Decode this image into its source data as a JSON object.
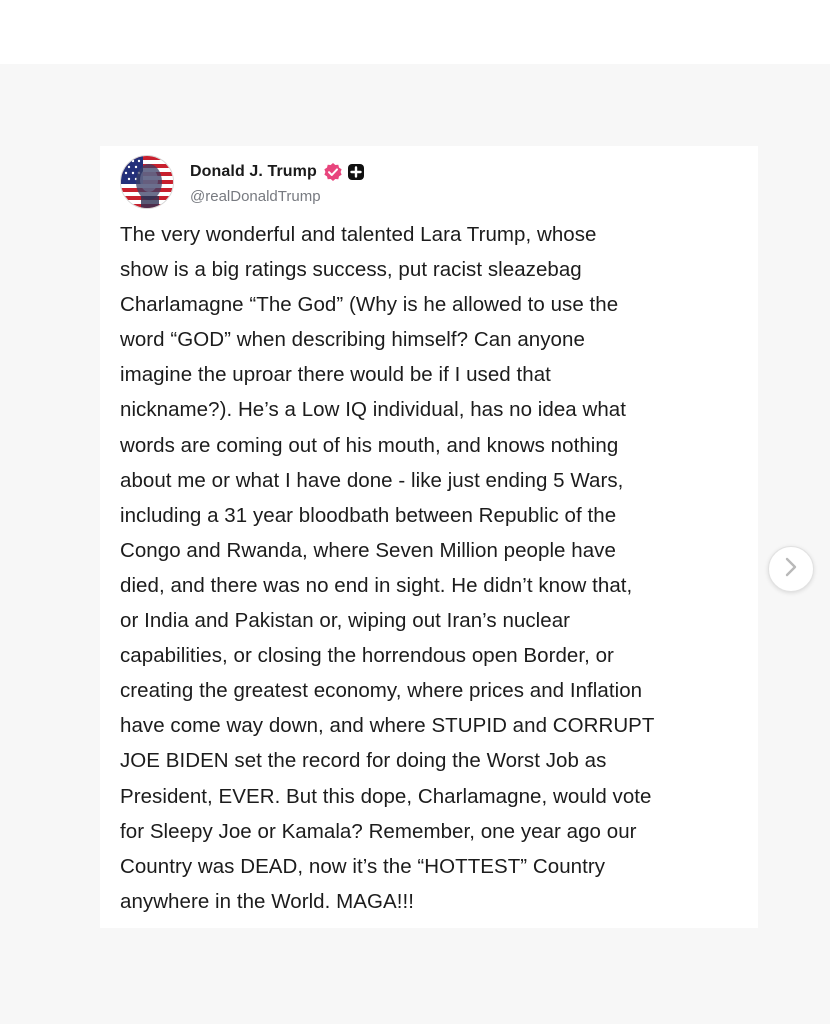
{
  "post": {
    "author": {
      "display_name": "Donald J. Trump",
      "handle": "@realDonaldTrump",
      "avatar": "flag-portrait-avatar",
      "verified_icon": "verified-badge-icon",
      "extra_icon": "plus-badge-icon"
    },
    "text": "The very wonderful and talented Lara Trump, whose\nshow is a big ratings success, put racist sleazebag\nCharlamagne “The God” (Why is he allowed  to use the\nword “GOD” when describing himself? Can anyone\nimagine the uproar there would be if I used that\nnickname?). He’s a Low IQ individual, has no idea what\nwords are coming out of his mouth, and knows nothing\nabout me or what I have done - like just ending 5 Wars,\nincluding a 31 year bloodbath between Republic of the\nCongo and Rwanda, where Seven Million people have\ndied, and there was no end in sight. He didn’t know that,\nor India and Pakistan or, wiping out Iran’s nuclear\ncapabilities, or closing the horrendous open Border, or\ncreating the greatest economy, where prices and Inflation\nhave come way down, and where STUPID and CORRUPT\nJOE BIDEN set the record for doing the Worst Job as\nPresident, EVER. But this dope, Charlamagne, would vote\nfor Sleepy Joe or Kamala? Remember, one year ago our\nCountry was DEAD, now it’s the “HOTTEST” Country\nanywhere in the World. MAGA!!!"
  },
  "carousel": {
    "next_icon": "chevron-right-icon"
  },
  "colors": {
    "verified_badge": "#e8457d",
    "text": "#1c1c1c",
    "handle": "#777a80"
  }
}
